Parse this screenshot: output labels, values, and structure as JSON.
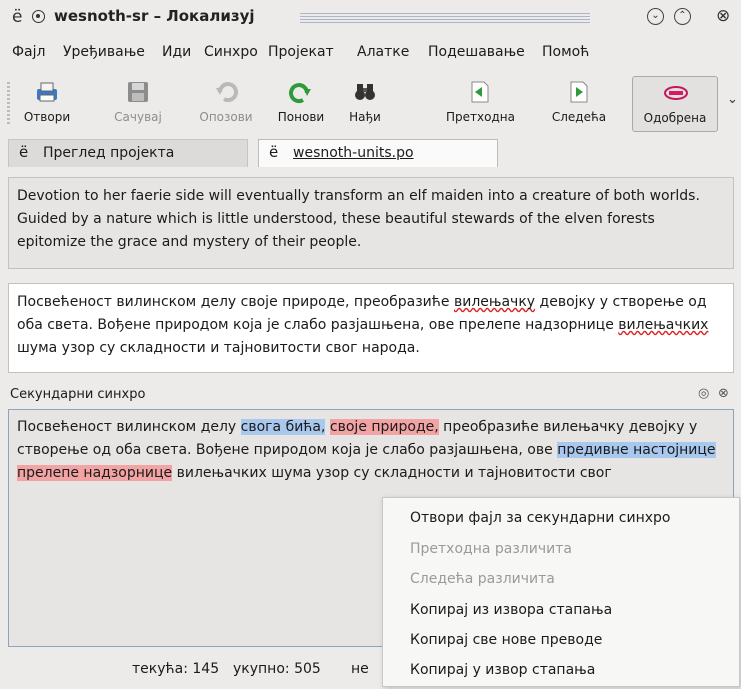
{
  "window": {
    "app_glyph": "ё",
    "title": "wesnoth-sr – Локализуј",
    "buttons": {
      "minimize": "⌄",
      "maximize": "⌃",
      "close": "⊗"
    }
  },
  "menubar": [
    {
      "label": "Фајл"
    },
    {
      "label": "Уређивање"
    },
    {
      "label": "Иди"
    },
    {
      "label": "Синхро"
    },
    {
      "label": "Пројекат"
    },
    {
      "label": "Алатке"
    },
    {
      "label": "Подешавање"
    },
    {
      "label": "Помоћ"
    }
  ],
  "toolbar": [
    {
      "label": "Отвори",
      "icon": "printer-open-icon",
      "enabled": true
    },
    {
      "label": "Сачувај",
      "icon": "floppy-save-icon",
      "enabled": false
    },
    {
      "label": "Опозови",
      "icon": "undo-arrow-icon",
      "enabled": false
    },
    {
      "label": "Понови",
      "icon": "redo-arrow-icon",
      "enabled": true
    },
    {
      "label": "Нађи",
      "icon": "binoculars-icon",
      "enabled": true
    },
    {
      "label": "Претходна",
      "icon": "previous-entry-icon",
      "enabled": true
    },
    {
      "label": "Следећа",
      "icon": "next-entry-icon",
      "enabled": true
    },
    {
      "label": "Одобрена",
      "icon": "approved-stamp-icon",
      "enabled": true,
      "checked": true
    }
  ],
  "tabs": [
    {
      "icon": "ё",
      "label": "Преглед пројекта",
      "active": false
    },
    {
      "icon": "ё",
      "label": "wesnoth-units.po",
      "active": true
    }
  ],
  "source_text": "Devotion to her faerie side will eventually transform an elf maiden into a creature of both worlds. Guided by a nature which is little understood, these beautiful stewards of the elven forests epitomize the grace and mystery of their people.",
  "target": {
    "p1": "Посвећеност вилинском делу своје природе, преобразиће ",
    "w1": "вилењачку",
    "p2": " девојку у створење од оба света. Вођене природом која је слабо разјашњена, ове прелепе надзорнице ",
    "w2": "вилењачких",
    "p3": " шума узор су складности и тајновитости свог народа."
  },
  "secondary": {
    "title": "Секундарни синхро",
    "text_parts": [
      {
        "text": "Посвећеност вилинском делу ",
        "hl": ""
      },
      {
        "text": "свога бића,",
        "hl": "blue"
      },
      {
        "text": " ",
        "hl": ""
      },
      {
        "text": "своје природе,",
        "hl": "red"
      },
      {
        "text": " преобразиће вилењачку девојку у створење од оба света. Вођене природом која је слабо разјашњена, ове ",
        "hl": ""
      },
      {
        "text": "предивне настојнице",
        "hl": "blue"
      },
      {
        "text": " ",
        "hl": ""
      },
      {
        "text": "прелепе надзорнице",
        "hl": "red"
      },
      {
        "text": " вилењачких шума узор су складности и тајновитости свог",
        "hl": ""
      }
    ]
  },
  "status": {
    "current": "текућа: 145",
    "total": "укупно: 505",
    "other": "не"
  },
  "context_menu": [
    {
      "label": "Отвори фајл за секундарни синхро",
      "enabled": true
    },
    {
      "label": "Претходна различита",
      "enabled": false
    },
    {
      "label": "Следећа различита",
      "enabled": false
    },
    {
      "label": "Копирај из извора стапања",
      "enabled": true
    },
    {
      "label": "Копирај све нове преводе",
      "enabled": true
    },
    {
      "label": "Копирај у извор стапања",
      "enabled": true
    }
  ],
  "colors": {
    "highlight_blue": "#a8c8ee",
    "highlight_red": "#f2a3a3",
    "spellcheck": "#dd2222"
  }
}
